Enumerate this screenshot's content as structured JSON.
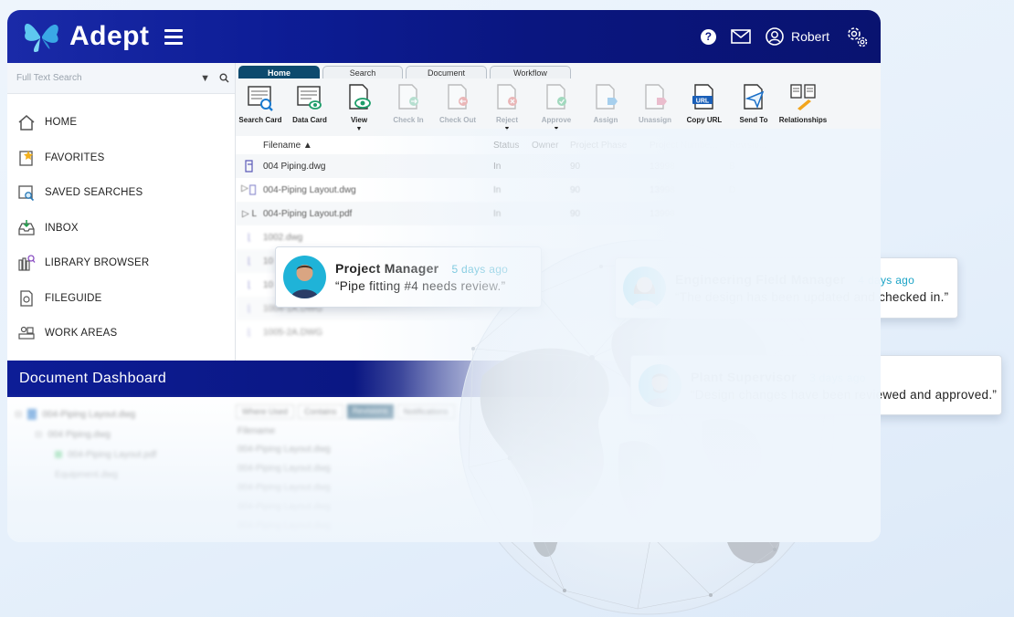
{
  "app": {
    "name": "Adept",
    "user": "Robert"
  },
  "search": {
    "placeholder": "Full Text Search"
  },
  "sidebar": {
    "items": [
      {
        "label": "HOME"
      },
      {
        "label": "FAVORITES"
      },
      {
        "label": "SAVED SEARCHES"
      },
      {
        "label": "INBOX"
      },
      {
        "label": "LIBRARY BROWSER"
      },
      {
        "label": "FILEGUIDE"
      },
      {
        "label": "WORK AREAS"
      }
    ]
  },
  "ribbon": {
    "tabs": [
      {
        "label": "Home",
        "active": true
      },
      {
        "label": "Search"
      },
      {
        "label": "Document"
      },
      {
        "label": "Workflow"
      }
    ],
    "tools": [
      {
        "label": "Search Card",
        "icon": "search-card-icon"
      },
      {
        "label": "Data Card",
        "icon": "data-card-icon"
      },
      {
        "label": "View",
        "icon": "view-icon"
      },
      {
        "label": "Check In",
        "icon": "check-in-icon"
      },
      {
        "label": "Check Out",
        "icon": "check-out-icon"
      },
      {
        "label": "Reject",
        "icon": "reject-icon"
      },
      {
        "label": "Approve",
        "icon": "approve-icon"
      },
      {
        "label": "Assign",
        "icon": "assign-icon"
      },
      {
        "label": "Unassign",
        "icon": "unassign-icon"
      },
      {
        "label": "Copy URL",
        "icon": "copy-url-icon"
      },
      {
        "label": "Send To",
        "icon": "send-to-icon"
      },
      {
        "label": "Relationships",
        "icon": "relationships-icon"
      }
    ]
  },
  "table": {
    "columns": [
      "Filename",
      "Status",
      "Owner",
      "Project Phase",
      "Project Numbe...",
      "Revisio..."
    ],
    "rows": [
      {
        "filename": "004 Piping.dwg",
        "status": "In",
        "phase": "90",
        "number": "13998",
        "rev": "B"
      },
      {
        "filename": "004-Piping Layout.dwg",
        "status": "In",
        "phase": "90",
        "number": "13998",
        "rev": "D"
      },
      {
        "filename": "004-Piping Layout.pdf",
        "status": "In",
        "phase": "90",
        "number": "13998",
        "rev": ""
      },
      {
        "filename": "1002.dwg",
        "status": "",
        "phase": "",
        "number": "",
        "rev": ""
      },
      {
        "filename": "10",
        "status": "",
        "phase": "",
        "number": "",
        "rev": ""
      },
      {
        "filename": "10",
        "status": "",
        "phase": "",
        "number": "",
        "rev": ""
      },
      {
        "filename": "1004-1A.DWG",
        "status": "",
        "phase": "",
        "number": "",
        "rev": ""
      },
      {
        "filename": "1005-2A.DWG",
        "status": "",
        "phase": "",
        "number": "",
        "rev": ""
      }
    ]
  },
  "dashboard": {
    "title": "Document Dashboard",
    "tree": [
      "004-Piping Layout.dwg",
      "004 Piping.dwg",
      "004-Piping Layout.pdf",
      "Equipment.dwg"
    ],
    "tabs": [
      "Where Used",
      "Contains",
      "Revisions",
      "Notifications"
    ],
    "column": "Filename",
    "rows": [
      "004-Piping Layout.dwg",
      "004-Piping Layout.dwg",
      "004-Piping Layout.dwg",
      "004-Piping Layout.dwg",
      "004-Piping Layout.dwg"
    ]
  },
  "comments": [
    {
      "name": "Project Manager",
      "time": "5 days ago",
      "message": "“Pipe fitting #4 needs review.”"
    },
    {
      "name": "Engineering Field Manager",
      "time": "4 days ago",
      "message": "“The design has been updated and checked in.”"
    },
    {
      "name": "Plant Supervisor",
      "time": "3 days ago",
      "message": "“Design changes have been reviewed and approved.”"
    }
  ],
  "colors": {
    "brand": "#0d1d96",
    "accent": "#1ba3c6",
    "tab_active": "#0d4a6e"
  }
}
